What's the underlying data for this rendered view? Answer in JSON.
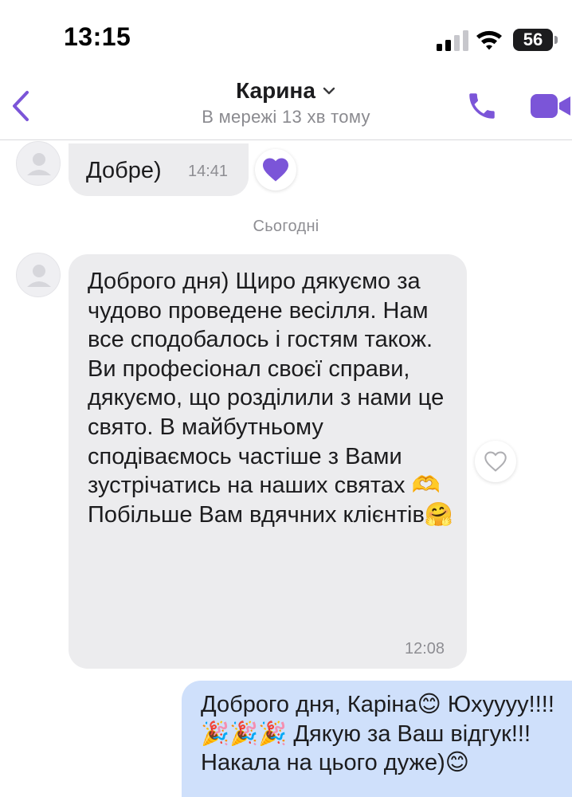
{
  "status_bar": {
    "time": "13:15",
    "battery_level": "56",
    "signal_icon": "cellular-signal-icon",
    "wifi_icon": "wifi-icon"
  },
  "header": {
    "contact_name": "Карина",
    "contact_status": "В мережі 13 хв тому",
    "accent_color": "#7b55d8",
    "icons": [
      "back-chevron-icon",
      "chevron-down-icon",
      "phone-icon",
      "video-camera-icon"
    ]
  },
  "chat": {
    "date_separator": "Сьогодні",
    "messages": [
      {
        "direction": "incoming",
        "text": "Добре)",
        "time": "14:41",
        "reaction": "heart-filled"
      },
      {
        "direction": "incoming",
        "text": "Доброго дня) Щиро дякуємо за чудово проведене весілля. Нам все сподобалось і гостям також. Ви професіонал своєї справи, дякуємо, що розділили з нами це свято. В майбутньому сподіваємось частіше з Вами зустрічатись на наших святах 🫶 Побільше Вам вдячних клієнтів🤗",
        "time": "12:08",
        "reaction": "heart-outline"
      },
      {
        "direction": "outgoing",
        "text": "Доброго дня, Каріна😊 Юхуууу!!!! 🎉🎉🎉 Дякую за Ваш відгук!!! Накала на цього дуже)😊"
      }
    ]
  },
  "colors": {
    "incoming_bubble": "#ececee",
    "outgoing_bubble": "#cfe0fb",
    "reaction_heart": "#7b55d8"
  }
}
